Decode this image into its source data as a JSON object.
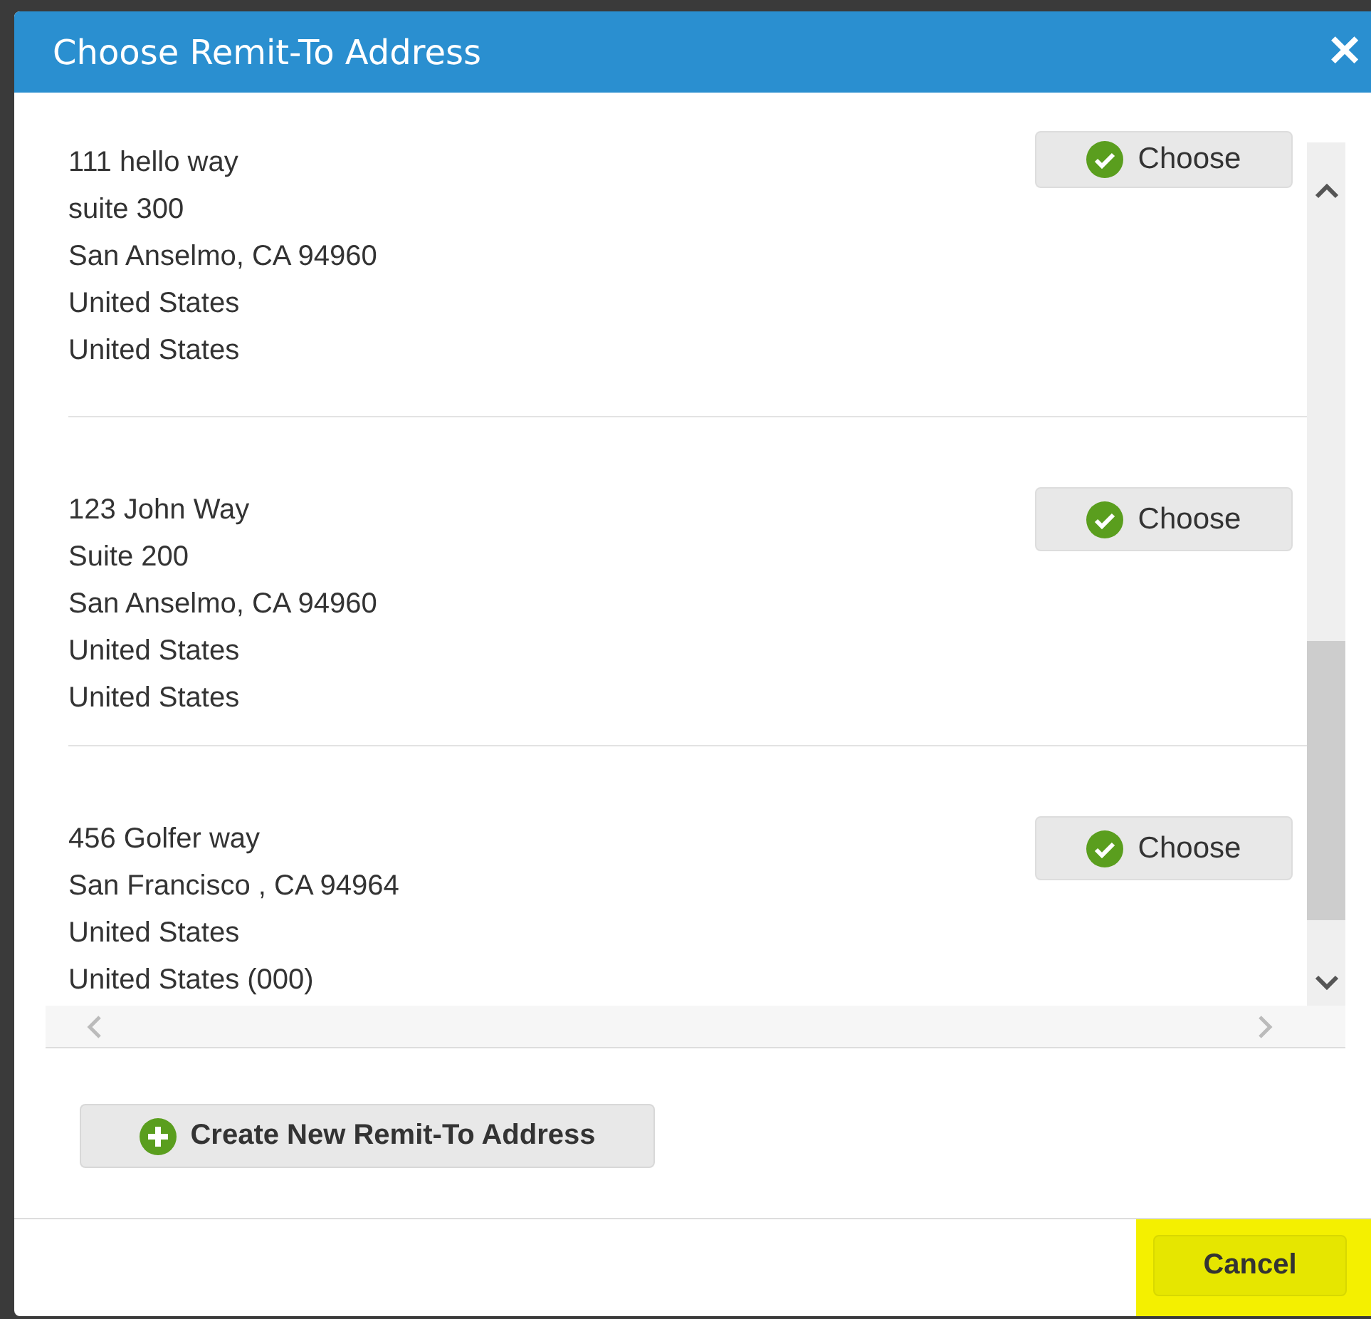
{
  "dialog": {
    "title": "Choose Remit-To Address",
    "close": "✕"
  },
  "addresses": [
    {
      "lines": [
        "111 hello way",
        "suite 300",
        "San Anselmo, CA 94960",
        "United States",
        "United States"
      ],
      "button": "Choose"
    },
    {
      "lines": [
        "123 John Way",
        "Suite 200",
        "San Anselmo, CA 94960",
        "United States",
        "United States"
      ],
      "button": "Choose"
    },
    {
      "lines": [
        "456 Golfer way",
        "San Francisco , CA 94964",
        "United States",
        "United States (000)"
      ],
      "button": "Choose"
    }
  ],
  "create_button": "Create New Remit-To Address",
  "footer": {
    "cancel": "Cancel",
    "highlighted": true
  }
}
